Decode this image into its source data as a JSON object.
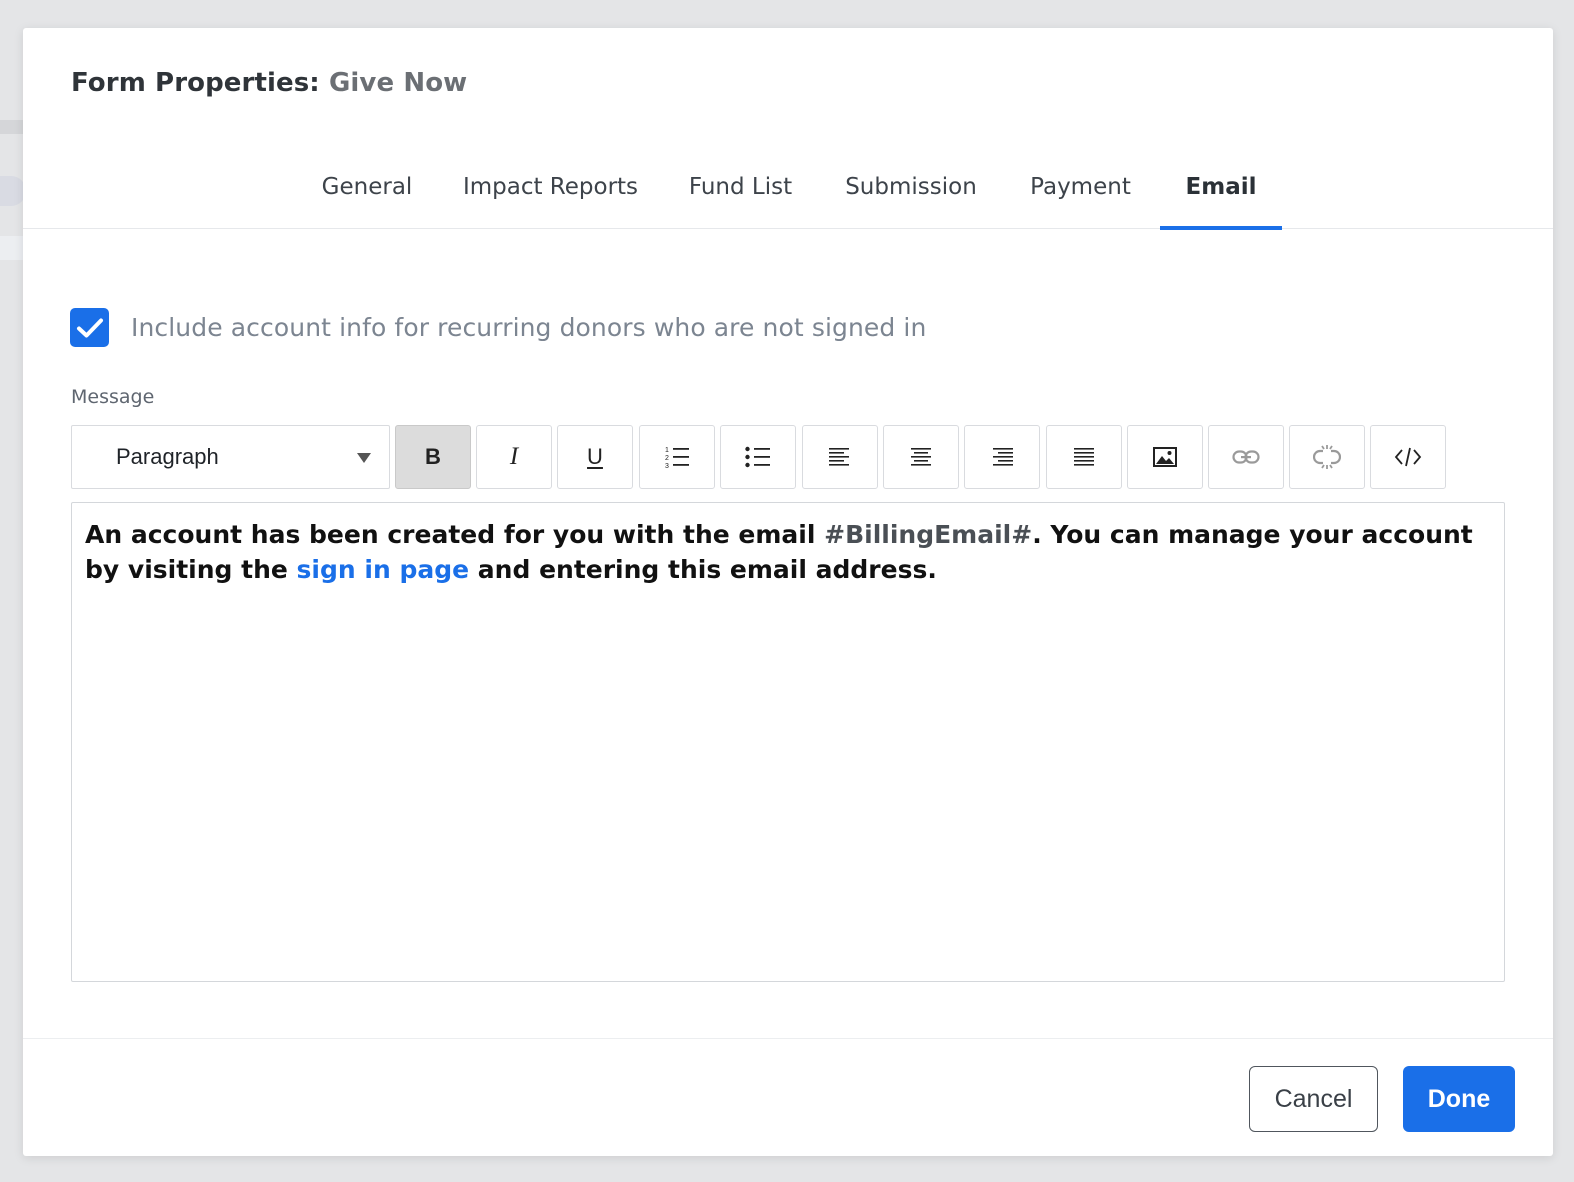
{
  "modal": {
    "title_prefix": "Form Properties:",
    "form_name": "Give Now"
  },
  "tabs": [
    {
      "label": "General",
      "active": false
    },
    {
      "label": "Impact Reports",
      "active": false
    },
    {
      "label": "Fund List",
      "active": false
    },
    {
      "label": "Submission",
      "active": false
    },
    {
      "label": "Payment",
      "active": false
    },
    {
      "label": "Email",
      "active": true
    }
  ],
  "settings": {
    "include_account_info_checked": true,
    "include_account_info_label": "Include account info for recurring donors who are not signed in"
  },
  "message": {
    "label": "Message",
    "toolbar": {
      "block_format": "Paragraph",
      "bold_label": "B",
      "italic_label": "I",
      "underline_label": "U",
      "icons": [
        "ordered-list-icon",
        "bullet-list-icon",
        "align-left-icon",
        "align-center-icon",
        "align-right-icon",
        "align-justify-icon",
        "image-icon",
        "link-icon",
        "unlink-icon",
        "code-view-icon"
      ]
    },
    "body": {
      "part1": "An account has been created for you with the email ",
      "token": "#BillingEmail#",
      "part2": ". You can manage your account by visiting the ",
      "link_text": "sign in page",
      "part3": " and entering this email address."
    }
  },
  "footer": {
    "cancel_label": "Cancel",
    "done_label": "Done"
  },
  "colors": {
    "accent": "#1a6fe8"
  }
}
